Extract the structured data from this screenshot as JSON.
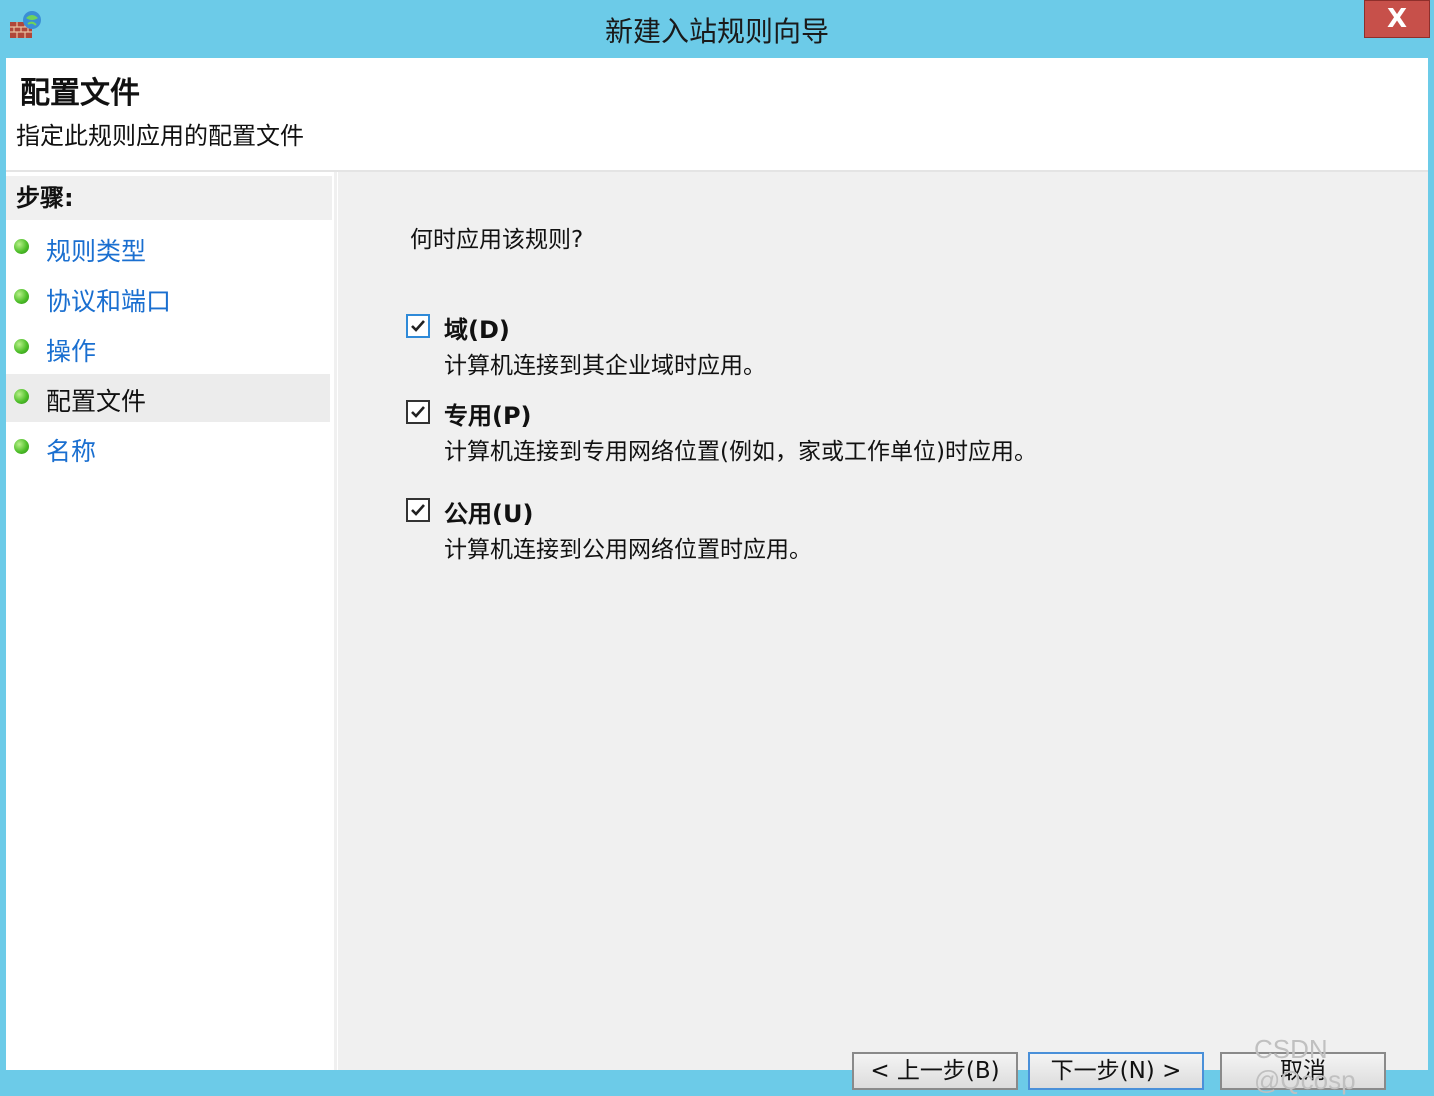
{
  "window": {
    "title": "新建入站规则向导",
    "close_label": "X"
  },
  "header": {
    "title": "配置文件",
    "subtitle": "指定此规则应用的配置文件"
  },
  "sidebar": {
    "steps_label": "步骤:",
    "items": [
      {
        "label": "规则类型"
      },
      {
        "label": "协议和端口"
      },
      {
        "label": "操作"
      },
      {
        "label": "配置文件"
      },
      {
        "label": "名称"
      }
    ]
  },
  "main": {
    "question": "何时应用该规则?",
    "options": [
      {
        "label": "域(D)",
        "description": "计算机连接到其企业域时应用。",
        "checked": true
      },
      {
        "label": "专用(P)",
        "description": "计算机连接到专用网络位置(例如，家或工作单位)时应用。",
        "checked": true
      },
      {
        "label": "公用(U)",
        "description": "计算机连接到公用网络位置时应用。",
        "checked": true
      }
    ]
  },
  "buttons": {
    "back": "< 上一步(B)",
    "next": "下一步(N) >",
    "cancel": "取消"
  },
  "watermark": "CSDN @Qcosp",
  "colors": {
    "titlebar": "#6ccbe8",
    "link": "#1a6fd0",
    "close": "#c7504a",
    "content_bg": "#f0f0f0"
  }
}
